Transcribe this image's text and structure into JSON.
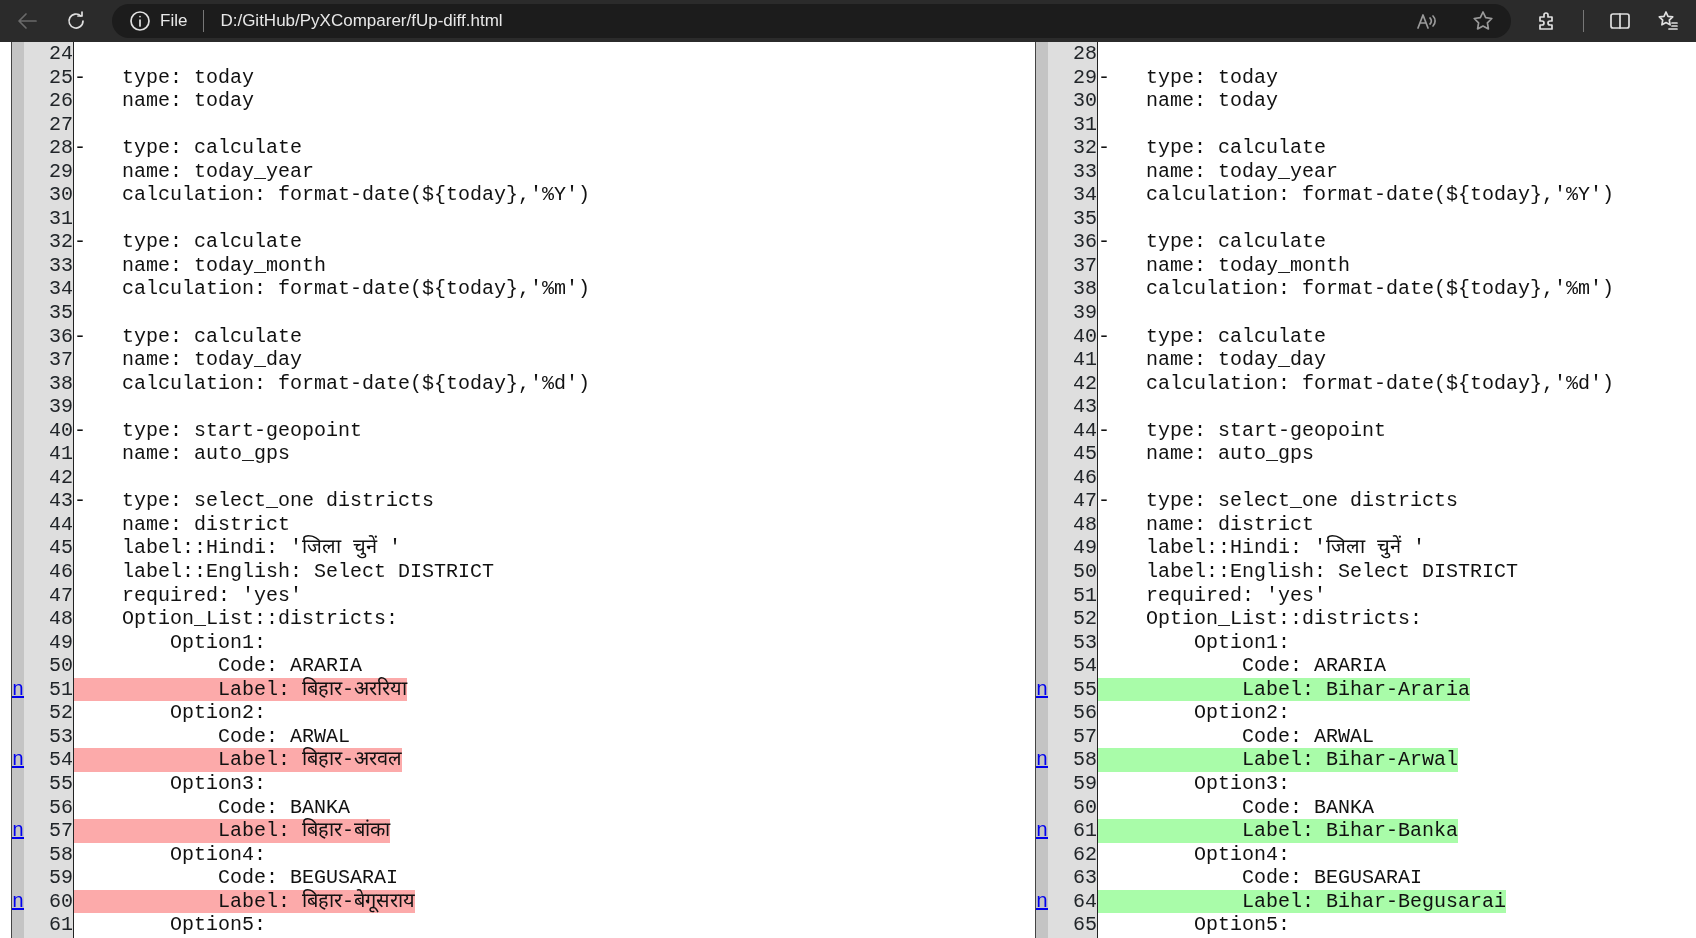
{
  "browser": {
    "back": {
      "disabled": true
    },
    "scheme": "File",
    "url": "D:/GitHub/PyXComparer/fUp-diff.html"
  },
  "panes": [
    {
      "kind": "old",
      "lines": [
        {
          "num": "24",
          "changed": false
        },
        {
          "num": "25",
          "changed": false,
          "marker": "-",
          "text": "   type: today"
        },
        {
          "num": "26",
          "changed": false,
          "text": "    name: today"
        },
        {
          "num": "27",
          "changed": false
        },
        {
          "num": "28",
          "changed": false,
          "marker": "-",
          "text": "   type: calculate"
        },
        {
          "num": "29",
          "changed": false,
          "text": "    name: today_year"
        },
        {
          "num": "30",
          "changed": false,
          "text": "    calculation: format-date(${today},'%Y')"
        },
        {
          "num": "31",
          "changed": false
        },
        {
          "num": "32",
          "changed": false,
          "marker": "-",
          "text": "   type: calculate"
        },
        {
          "num": "33",
          "changed": false,
          "text": "    name: today_month"
        },
        {
          "num": "34",
          "changed": false,
          "text": "    calculation: format-date(${today},'%m')"
        },
        {
          "num": "35",
          "changed": false
        },
        {
          "num": "36",
          "changed": false,
          "marker": "-",
          "text": "   type: calculate"
        },
        {
          "num": "37",
          "changed": false,
          "text": "    name: today_day"
        },
        {
          "num": "38",
          "changed": false,
          "text": "    calculation: format-date(${today},'%d')"
        },
        {
          "num": "39",
          "changed": false
        },
        {
          "num": "40",
          "changed": false,
          "marker": "-",
          "text": "   type: start-geopoint"
        },
        {
          "num": "41",
          "changed": false,
          "text": "    name: auto_gps"
        },
        {
          "num": "42",
          "changed": false
        },
        {
          "num": "43",
          "changed": false,
          "marker": "-",
          "text": "   type: select_one districts"
        },
        {
          "num": "44",
          "changed": false,
          "text": "    name: district"
        },
        {
          "num": "45",
          "changed": false,
          "text": "    label::Hindi: 'जिला चुनें '"
        },
        {
          "num": "46",
          "changed": false,
          "text": "    label::English: Select DISTRICT"
        },
        {
          "num": "47",
          "changed": false,
          "text": "    required: 'yes'"
        },
        {
          "num": "48",
          "changed": false,
          "text": "    Option_List::districts:"
        },
        {
          "num": "49",
          "changed": false,
          "text": "        Option1:"
        },
        {
          "num": "50",
          "changed": false,
          "text": "            Code: ARARIA"
        },
        {
          "num": "51",
          "link": "n",
          "changed": true,
          "text": "            Label: बिहार-अररिया"
        },
        {
          "num": "52",
          "changed": false,
          "text": "        Option2:"
        },
        {
          "num": "53",
          "changed": false,
          "text": "            Code: ARWAL"
        },
        {
          "num": "54",
          "link": "n",
          "changed": true,
          "text": "            Label: बिहार-अरवल"
        },
        {
          "num": "55",
          "changed": false,
          "text": "        Option3:"
        },
        {
          "num": "56",
          "changed": false,
          "text": "            Code: BANKA"
        },
        {
          "num": "57",
          "link": "n",
          "changed": true,
          "text": "            Label: बिहार-बांका"
        },
        {
          "num": "58",
          "changed": false,
          "text": "        Option4:"
        },
        {
          "num": "59",
          "changed": false,
          "text": "            Code: BEGUSARAI"
        },
        {
          "num": "60",
          "link": "n",
          "changed": true,
          "text": "            Label: बिहार-बेगूसराय"
        },
        {
          "num": "61",
          "changed": false,
          "text": "        Option5:"
        }
      ]
    },
    {
      "kind": "new",
      "lines": [
        {
          "num": "28",
          "changed": false
        },
        {
          "num": "29",
          "changed": false,
          "marker": "-",
          "text": "   type: today"
        },
        {
          "num": "30",
          "changed": false,
          "text": "    name: today"
        },
        {
          "num": "31",
          "changed": false
        },
        {
          "num": "32",
          "changed": false,
          "marker": "-",
          "text": "   type: calculate"
        },
        {
          "num": "33",
          "changed": false,
          "text": "    name: today_year"
        },
        {
          "num": "34",
          "changed": false,
          "text": "    calculation: format-date(${today},'%Y')"
        },
        {
          "num": "35",
          "changed": false
        },
        {
          "num": "36",
          "changed": false,
          "marker": "-",
          "text": "   type: calculate"
        },
        {
          "num": "37",
          "changed": false,
          "text": "    name: today_month"
        },
        {
          "num": "38",
          "changed": false,
          "text": "    calculation: format-date(${today},'%m')"
        },
        {
          "num": "39",
          "changed": false
        },
        {
          "num": "40",
          "changed": false,
          "marker": "-",
          "text": "   type: calculate"
        },
        {
          "num": "41",
          "changed": false,
          "text": "    name: today_day"
        },
        {
          "num": "42",
          "changed": false,
          "text": "    calculation: format-date(${today},'%d')"
        },
        {
          "num": "43",
          "changed": false
        },
        {
          "num": "44",
          "changed": false,
          "marker": "-",
          "text": "   type: start-geopoint"
        },
        {
          "num": "45",
          "changed": false,
          "text": "    name: auto_gps"
        },
        {
          "num": "46",
          "changed": false
        },
        {
          "num": "47",
          "changed": false,
          "marker": "-",
          "text": "   type: select_one districts"
        },
        {
          "num": "48",
          "changed": false,
          "text": "    name: district"
        },
        {
          "num": "49",
          "changed": false,
          "text": "    label::Hindi: 'जिला चुनें '"
        },
        {
          "num": "50",
          "changed": false,
          "text": "    label::English: Select DISTRICT"
        },
        {
          "num": "51",
          "changed": false,
          "text": "    required: 'yes'"
        },
        {
          "num": "52",
          "changed": false,
          "text": "    Option_List::districts:"
        },
        {
          "num": "53",
          "changed": false,
          "text": "        Option1:"
        },
        {
          "num": "54",
          "changed": false,
          "text": "            Code: ARARIA"
        },
        {
          "num": "55",
          "link": "n",
          "changed": true,
          "text": "            Label: Bihar-Araria"
        },
        {
          "num": "56",
          "changed": false,
          "text": "        Option2:"
        },
        {
          "num": "57",
          "changed": false,
          "text": "            Code: ARWAL"
        },
        {
          "num": "58",
          "link": "n",
          "changed": true,
          "text": "            Label: Bihar-Arwal"
        },
        {
          "num": "59",
          "changed": false,
          "text": "        Option3:"
        },
        {
          "num": "60",
          "changed": false,
          "text": "            Code: BANKA"
        },
        {
          "num": "61",
          "link": "n",
          "changed": true,
          "text": "            Label: Bihar-Banka"
        },
        {
          "num": "62",
          "changed": false,
          "text": "        Option4:"
        },
        {
          "num": "63",
          "changed": false,
          "text": "            Code: BEGUSARAI"
        },
        {
          "num": "64",
          "link": "n",
          "changed": true,
          "text": "            Label: Bihar-Begusarai"
        },
        {
          "num": "65",
          "changed": false,
          "text": "        Option5:"
        }
      ]
    }
  ]
}
